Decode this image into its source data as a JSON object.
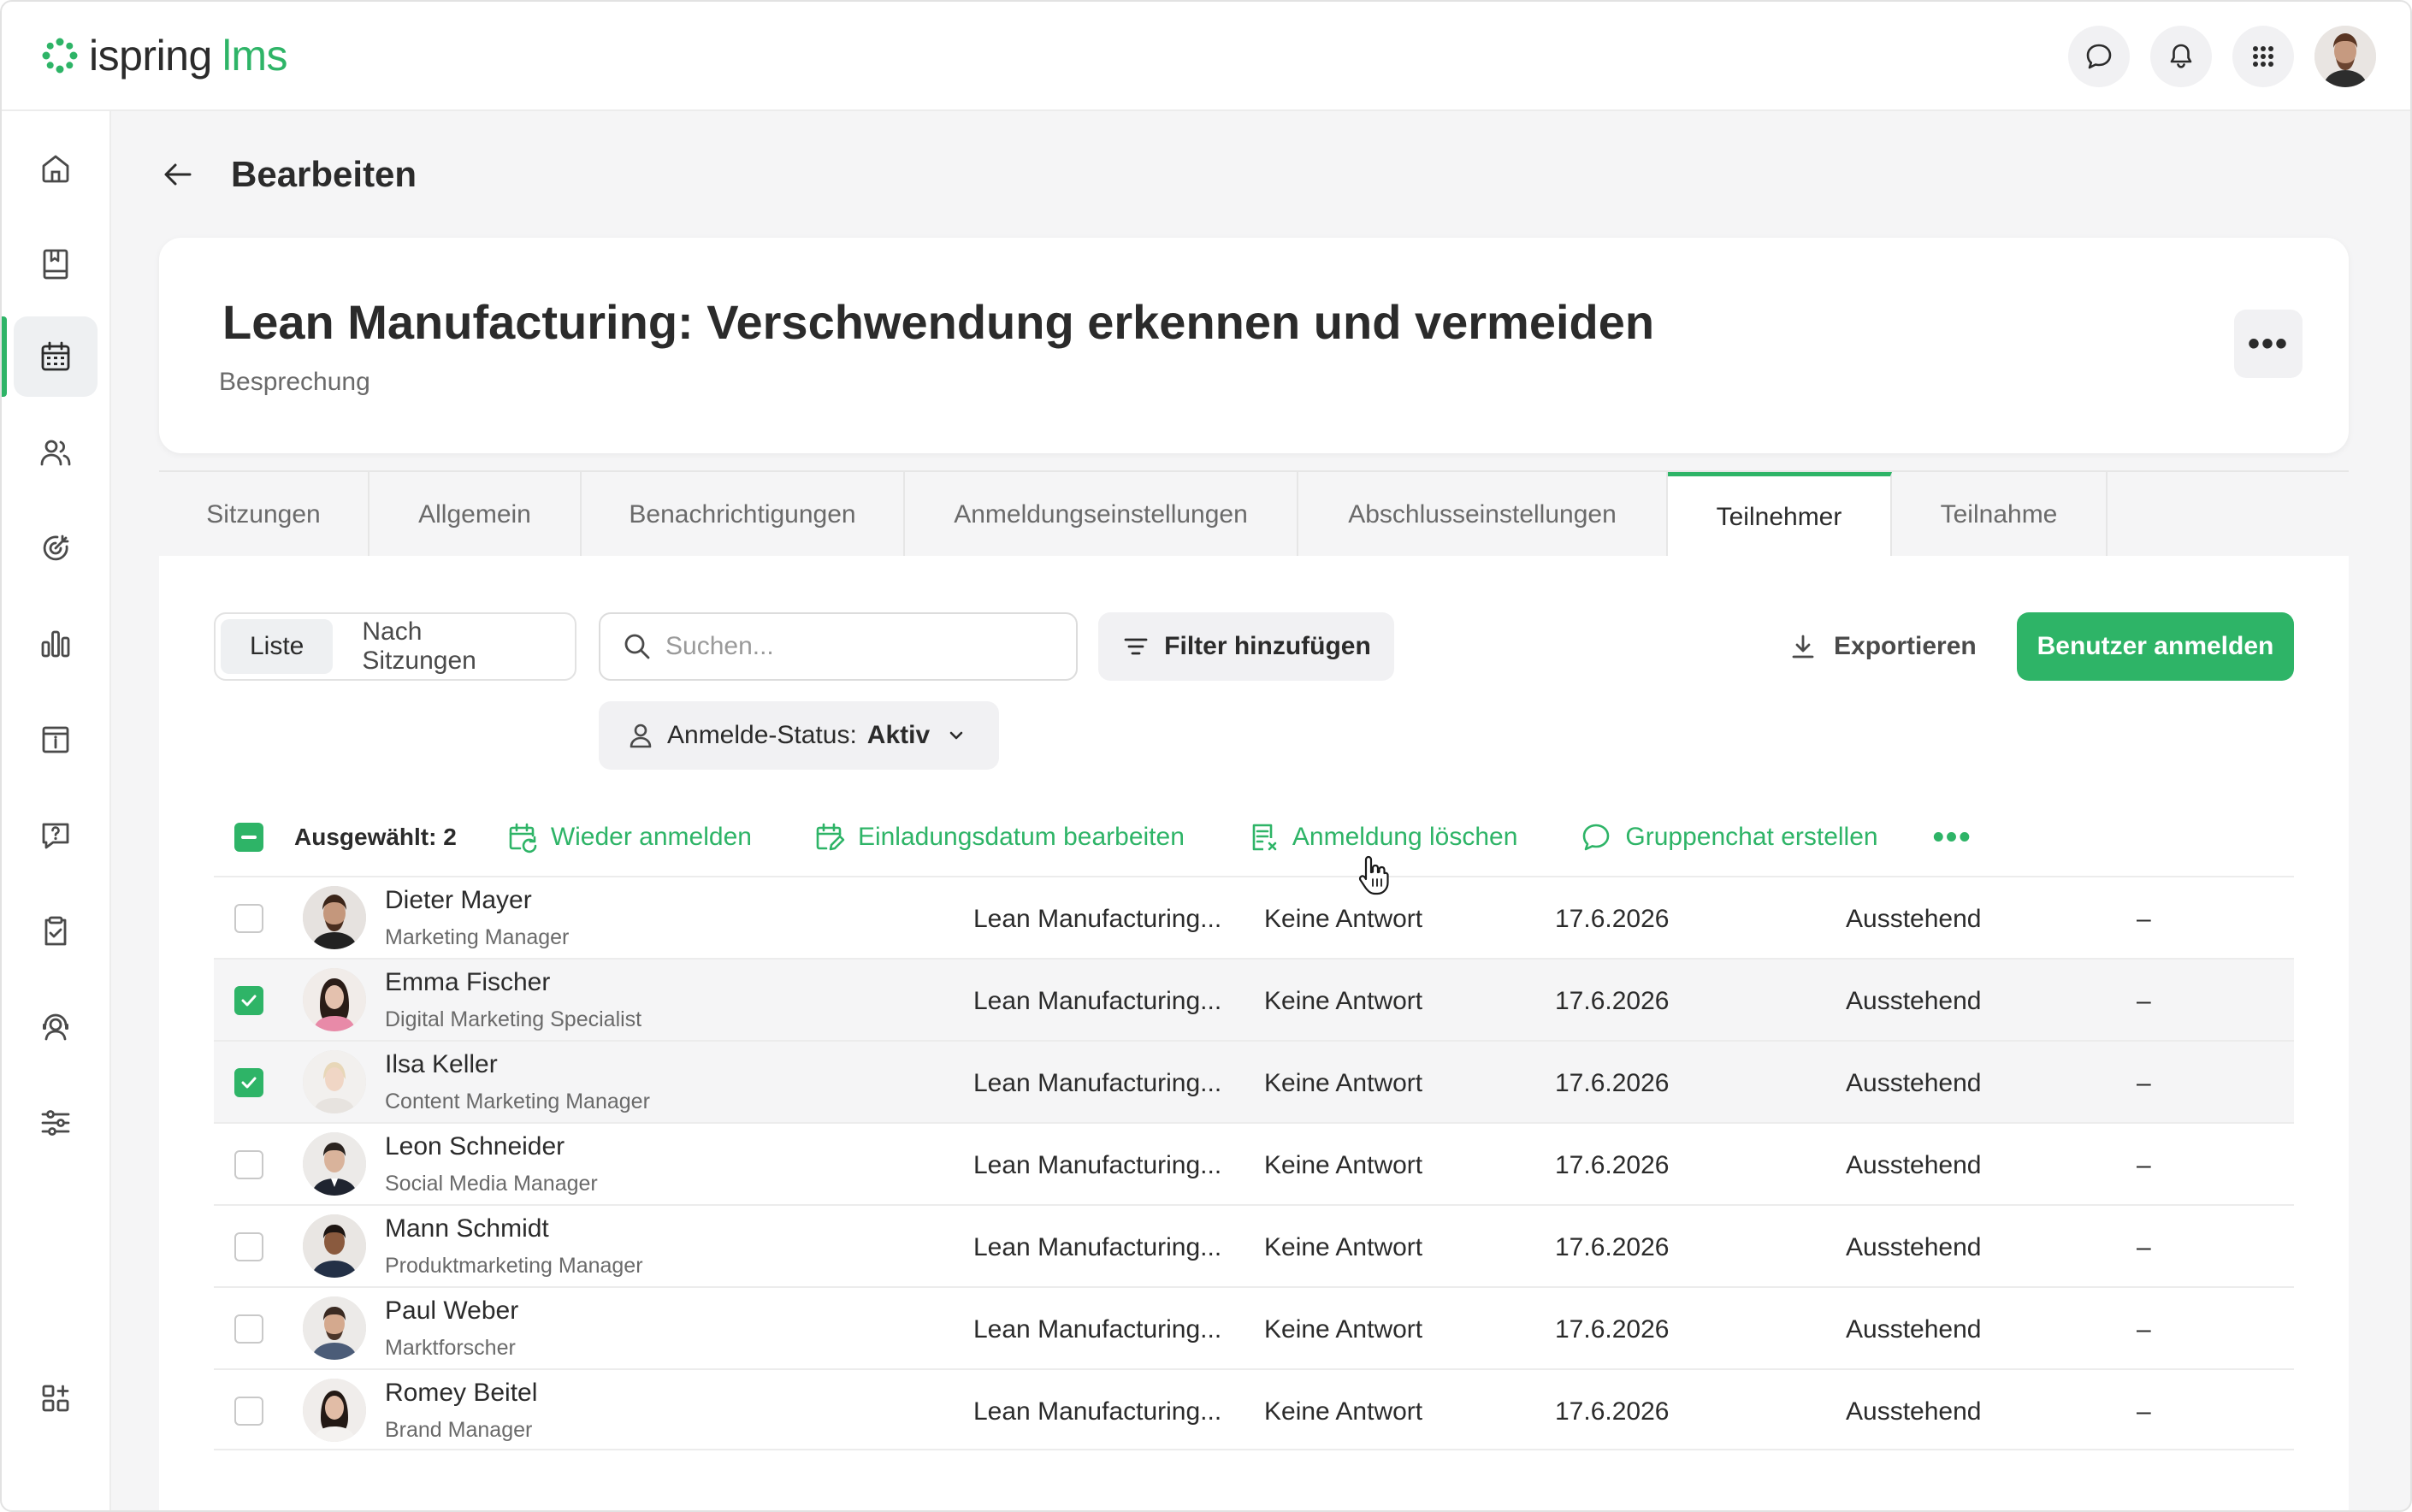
{
  "app": {
    "logo_main": "ispring",
    "logo_suffix": "lms"
  },
  "page": {
    "title": "Bearbeiten"
  },
  "course": {
    "title": "Lean Manufacturing: Verschwendung erkennen und vermeiden",
    "subtitle": "Besprechung"
  },
  "tabs": [
    {
      "label": "Sitzungen"
    },
    {
      "label": "Allgemein"
    },
    {
      "label": "Benachrichtigungen"
    },
    {
      "label": "Anmeldungseinstellungen"
    },
    {
      "label": "Abschlusseinstellungen"
    },
    {
      "label": "Teilnehmer",
      "active": true
    },
    {
      "label": "Teilnahme"
    }
  ],
  "view_toggle": {
    "list": "Liste",
    "by_sessions": "Nach Sitzungen"
  },
  "search": {
    "placeholder": "Suchen..."
  },
  "filter": {
    "label": "Filter hinzufügen"
  },
  "export": {
    "label": "Exportieren"
  },
  "enroll": {
    "label": "Benutzer anmelden"
  },
  "status_filter": {
    "label": "Anmelde-Status:",
    "value": "Aktiv"
  },
  "bulk": {
    "selected": "Ausgewählt: 2",
    "re_enroll": "Wieder anmelden",
    "edit_invite": "Einladungsdatum bearbeiten",
    "delete_enroll": "Anmeldung löschen",
    "group_chat": "Gruppenchat erstellen"
  },
  "rows": [
    {
      "name": "Dieter Mayer",
      "role": "Marketing Manager",
      "course": "Lean Manufacturing...",
      "response": "Keine Antwort",
      "date": "17.6.2026",
      "status": "Ausstehend",
      "c1": "–",
      "c2": "–",
      "checked": false
    },
    {
      "name": "Emma Fischer",
      "role": "Digital Marketing Specialist",
      "course": "Lean Manufacturing...",
      "response": "Keine Antwort",
      "date": "17.6.2026",
      "status": "Ausstehend",
      "c1": "–",
      "c2": "–",
      "checked": true
    },
    {
      "name": "Ilsa Keller",
      "role": "Content Marketing Manager",
      "course": "Lean Manufacturing...",
      "response": "Keine Antwort",
      "date": "17.6.2026",
      "status": "Ausstehend",
      "c1": "–",
      "c2": "–",
      "checked": true
    },
    {
      "name": "Leon Schneider",
      "role": "Social Media Manager",
      "course": "Lean Manufacturing...",
      "response": "Keine Antwort",
      "date": "17.6.2026",
      "status": "Ausstehend",
      "c1": "–",
      "c2": "–",
      "checked": false
    },
    {
      "name": "Mann Schmidt",
      "role": "Produktmarketing Manager",
      "course": "Lean Manufacturing...",
      "response": "Keine Antwort",
      "date": "17.6.2026",
      "status": "Ausstehend",
      "c1": "–",
      "c2": "–",
      "checked": false
    },
    {
      "name": "Paul Weber",
      "role": "Marktforscher",
      "course": "Lean Manufacturing...",
      "response": "Keine Antwort",
      "date": "17.6.2026",
      "status": "Ausstehend",
      "c1": "–",
      "c2": "–",
      "checked": false
    },
    {
      "name": "Romey Beitel",
      "role": "Brand Manager",
      "course": "Lean Manufacturing...",
      "response": "Keine Antwort",
      "date": "17.6.2026",
      "status": "Ausstehend",
      "c1": "–",
      "c2": "–",
      "checked": false
    }
  ],
  "colors": {
    "accent": "#2eb467",
    "text": "#2b2b2b",
    "muted": "#6a6a6a",
    "background": "#f5f5f6"
  },
  "icons": {
    "sidebar": [
      "home-icon",
      "book-icon",
      "calendar-icon",
      "users-icon",
      "target-icon",
      "chart-icon",
      "info-board-icon",
      "question-icon",
      "clipboard-check-icon",
      "support-agent-icon",
      "sliders-icon",
      "add-widget-icon"
    ],
    "topbar": [
      "chat-icon",
      "bell-icon",
      "apps-grid-icon"
    ]
  }
}
